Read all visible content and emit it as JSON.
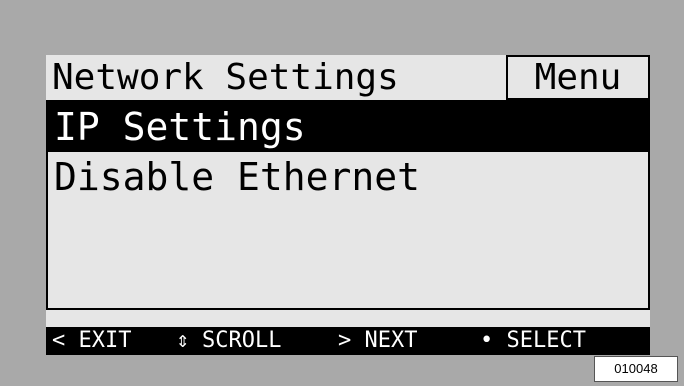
{
  "header": {
    "title": "Network Settings",
    "menu_label": "Menu"
  },
  "menu": {
    "items": [
      {
        "label": "IP Settings",
        "selected": true
      },
      {
        "label": "Disable Ethernet",
        "selected": false
      }
    ]
  },
  "footer": {
    "exit": "< EXIT",
    "scroll_icon": "up-down-arrow-icon",
    "scroll_glyph": "⇕",
    "scroll": "SCROLL",
    "next": "> NEXT",
    "select": "• SELECT"
  },
  "figure_ref": "010048",
  "colors": {
    "background": "#a9a9a9",
    "screen": "#e6e6e6",
    "highlight": "#000000",
    "highlight_text": "#ffffff"
  }
}
